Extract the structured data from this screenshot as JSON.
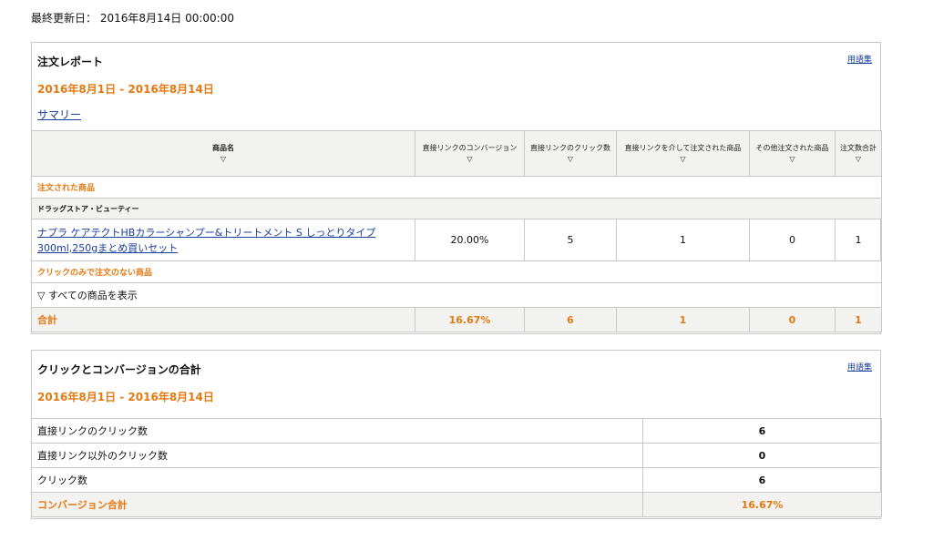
{
  "last_updated": "最終更新日： 2016年8月14日 00:00:00",
  "order_report": {
    "title": "注文レポート",
    "glossary_label": "用語集",
    "date_range": "2016年8月1日 - 2016年8月14日",
    "summary_link": "サマリー",
    "sort_icon": "▽",
    "columns": [
      "商品名",
      "直接リンクのコンバージョン",
      "直接リンクのクリック数",
      "直接リンクを介して注文された商品",
      "その他注文された商品",
      "注文数合計"
    ],
    "ordered_section_label": "注文された商品",
    "category": "ドラッグストア・ビューティー",
    "items": [
      {
        "name": "ナプラ ケアテクトHBカラーシャンプー&トリートメント S しっとりタイプ 300ml,250gまとめ買いセット",
        "conversion": "20.00%",
        "direct_clicks": "5",
        "direct_ordered": "1",
        "other_ordered": "0",
        "total_ordered": "1"
      }
    ],
    "clicks_only_section_label": "クリックのみで注文のない商品",
    "show_all_label": "▽ すべての商品を表示",
    "total": {
      "label": "合計",
      "conversion": "16.67%",
      "direct_clicks": "6",
      "direct_ordered": "1",
      "other_ordered": "0",
      "total_ordered": "1"
    }
  },
  "click_conversion": {
    "title": "クリックとコンバージョンの合計",
    "glossary_label": "用語集",
    "date_range": "2016年8月1日 - 2016年8月14日",
    "rows": [
      {
        "label": "直接リンクのクリック数",
        "value": "6"
      },
      {
        "label": "直接リンク以外のクリック数",
        "value": "0"
      },
      {
        "label": "クリック数",
        "value": "6"
      }
    ],
    "conversion_total": {
      "label": "コンバージョン合計",
      "value": "16.67%"
    }
  },
  "colors": {
    "accent": "#e47911",
    "link": "#1a3f9c",
    "header_bg": "#f2f2f0",
    "border": "#c8c8c8"
  }
}
